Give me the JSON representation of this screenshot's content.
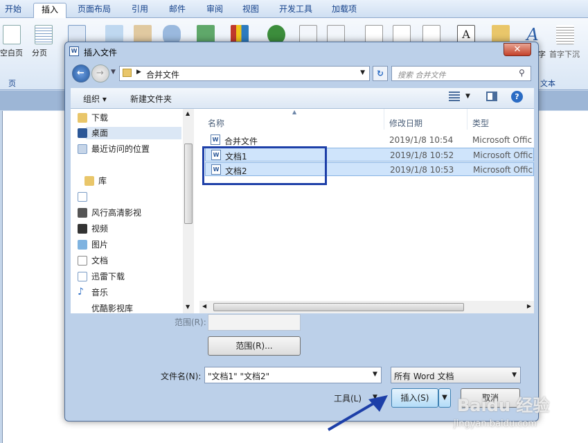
{
  "ribbon": {
    "tabs": [
      "开始",
      "插入",
      "页面布局",
      "引用",
      "邮件",
      "审阅",
      "视图",
      "开发工具",
      "加载项"
    ],
    "active_tab": "插入",
    "left_buttons": [
      "空白页",
      "分页"
    ],
    "group_left": "页",
    "right_buttons": [
      "字",
      "首字下沉"
    ],
    "group_right": "文本"
  },
  "dialog": {
    "title": "插入文件",
    "close": "✕",
    "address": "合并文件",
    "search_placeholder": "搜索 合并文件",
    "organize": "组织 ▾",
    "new_folder": "新建文件夹",
    "nav": [
      {
        "label": "下载",
        "icon": "download-folder-icon"
      },
      {
        "label": "桌面",
        "icon": "desktop-icon"
      },
      {
        "label": "最近访问的位置",
        "icon": "recent-places-icon"
      },
      {
        "label": "库",
        "icon": "library-icon"
      },
      {
        "label": "",
        "icon": "library-item-icon"
      },
      {
        "label": "风行高清影视",
        "icon": "video-library-icon"
      },
      {
        "label": "视频",
        "icon": "video-icon"
      },
      {
        "label": "图片",
        "icon": "picture-icon"
      },
      {
        "label": "文档",
        "icon": "document-icon"
      },
      {
        "label": "迅雷下载",
        "icon": "download-icon"
      },
      {
        "label": "音乐",
        "icon": "music-icon"
      },
      {
        "label": "优酷影视库",
        "icon": "video-library-icon"
      }
    ],
    "columns": [
      "名称",
      "修改日期",
      "类型"
    ],
    "files": [
      {
        "name": "合并文件",
        "date": "2019/1/8 10:54",
        "type": "Microsoft Offic",
        "selected": false
      },
      {
        "name": "文档1",
        "date": "2019/1/8 10:52",
        "type": "Microsoft Offic",
        "selected": true
      },
      {
        "name": "文档2",
        "date": "2019/1/8 10:53",
        "type": "Microsoft Offic",
        "selected": true
      }
    ],
    "range_label": "范围(R):",
    "range_button": "范围(R)...",
    "filename_label": "文件名(N):",
    "filename_value": "\"文档1\" \"文档2\"",
    "filetype": "所有 Word 文档",
    "tools": "工具(L)",
    "insert": "插入(S)",
    "cancel": "取消"
  },
  "watermark": {
    "brand": "Baidu 经验",
    "url": "jingyan.baidu.com"
  },
  "colors": {
    "highlight": "#1d3fa8",
    "arrow": "#1d3fa8",
    "selection": "#cfe4fb"
  }
}
